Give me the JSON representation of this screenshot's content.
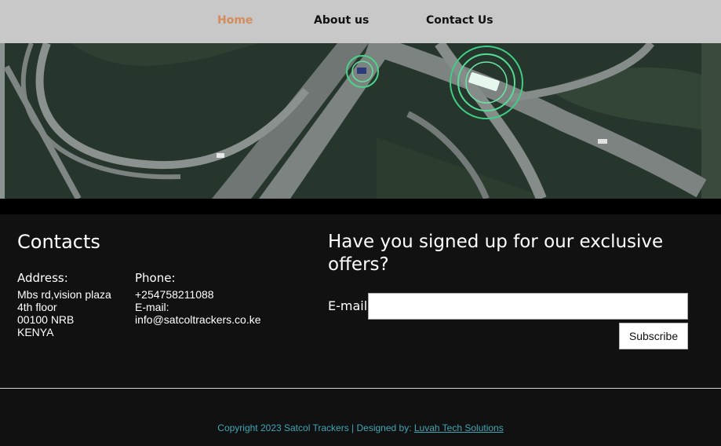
{
  "nav": {
    "home": "Home",
    "about": "About us",
    "contact": "Contact Us"
  },
  "contacts": {
    "title": "Contacts",
    "address_label": "Address:",
    "address_lines": [
      "Mbs rd,vision plaza",
      "4th floor",
      "00100 NRB",
      "KENYA"
    ],
    "phone_label": "Phone:",
    "phone": "+254758211088",
    "email_label": "E-mail:",
    "email": "info@satcoltrackers.co.ke"
  },
  "signup": {
    "title": "Have you signed up for our exclusive offers?",
    "email_label": "E-mail",
    "email_value": "",
    "subscribe_label": "Subscribe"
  },
  "footer": {
    "copyright": "Copyright 2023 Satcol Trackers | Designed by: ",
    "designer": "Luvah Tech Solutions"
  },
  "colors": {
    "nav_active": "#d48c5a",
    "footer_text": "#3fa7b5",
    "background": "#111111",
    "navbar": "#c8c8c8"
  }
}
